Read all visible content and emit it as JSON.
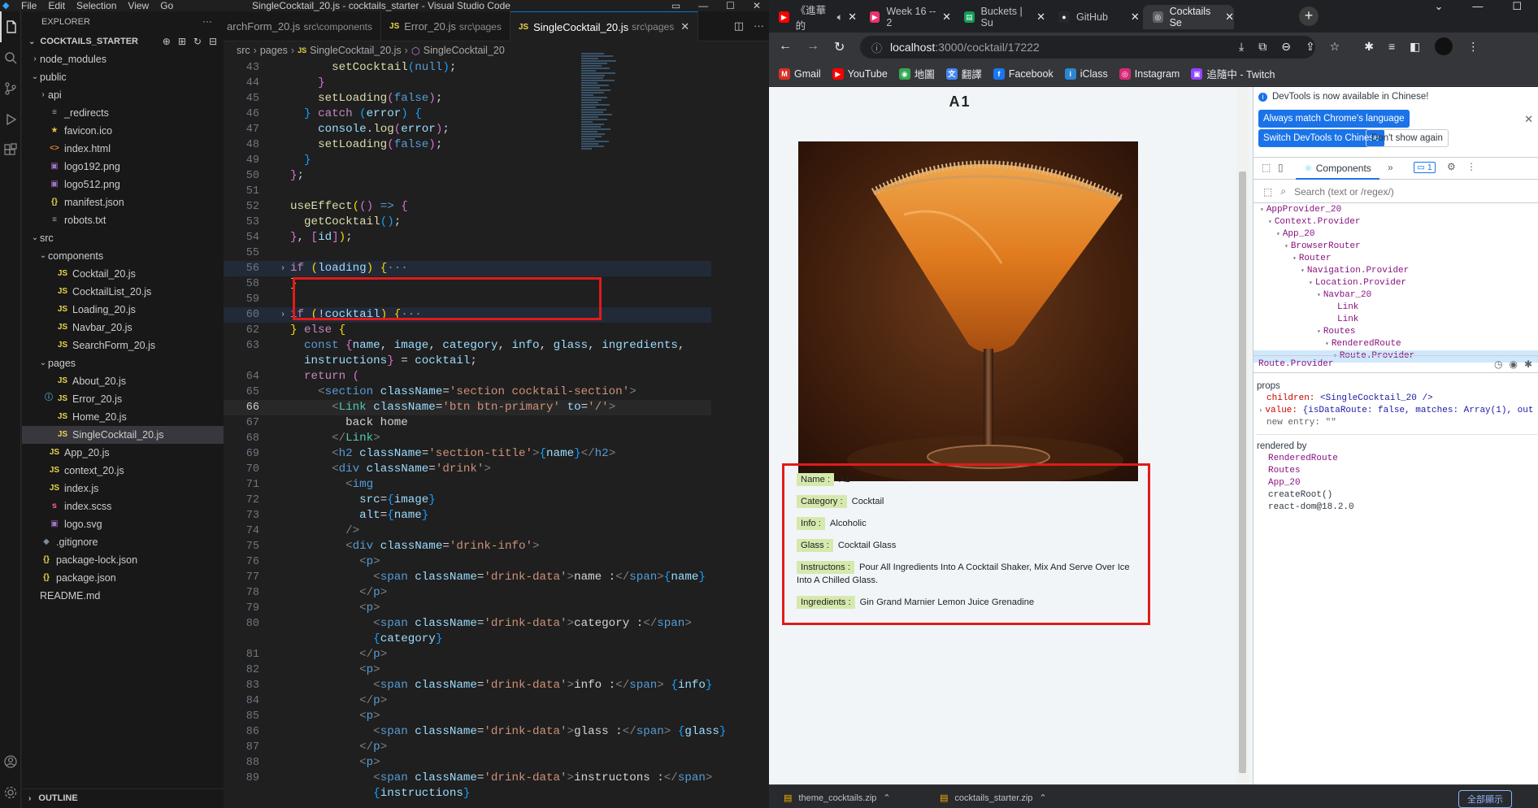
{
  "vscode": {
    "window_title": "SingleCocktail_20.js - cocktails_starter - Visual Studio Code",
    "menu": [
      "File",
      "Edit",
      "Selection",
      "View",
      "Go"
    ],
    "explorer_label": "EXPLORER",
    "project_label": "COCKTAILS_STARTER",
    "outline_label": "OUTLINE",
    "tree": [
      {
        "name": "node_modules",
        "kind": "folder",
        "depth": 0,
        "open": false,
        "icon": ""
      },
      {
        "name": "public",
        "kind": "folder",
        "depth": 0,
        "open": true,
        "icon": ""
      },
      {
        "name": "api",
        "kind": "folder",
        "depth": 1,
        "open": false,
        "icon": ""
      },
      {
        "name": "_redirects",
        "kind": "file",
        "depth": 1,
        "icon": "txt"
      },
      {
        "name": "favicon.ico",
        "kind": "file",
        "depth": 1,
        "icon": "star"
      },
      {
        "name": "index.html",
        "kind": "file",
        "depth": 1,
        "icon": "html"
      },
      {
        "name": "logo192.png",
        "kind": "file",
        "depth": 1,
        "icon": "img"
      },
      {
        "name": "logo512.png",
        "kind": "file",
        "depth": 1,
        "icon": "img"
      },
      {
        "name": "manifest.json",
        "kind": "file",
        "depth": 1,
        "icon": "json"
      },
      {
        "name": "robots.txt",
        "kind": "file",
        "depth": 1,
        "icon": "txt"
      },
      {
        "name": "src",
        "kind": "folder",
        "depth": 0,
        "open": true,
        "icon": ""
      },
      {
        "name": "components",
        "kind": "folder",
        "depth": 1,
        "open": true,
        "icon": ""
      },
      {
        "name": "Cocktail_20.js",
        "kind": "file",
        "depth": 2,
        "icon": "js"
      },
      {
        "name": "CocktailList_20.js",
        "kind": "file",
        "depth": 2,
        "icon": "js"
      },
      {
        "name": "Loading_20.js",
        "kind": "file",
        "depth": 2,
        "icon": "js"
      },
      {
        "name": "Navbar_20.js",
        "kind": "file",
        "depth": 2,
        "icon": "js"
      },
      {
        "name": "SearchForm_20.js",
        "kind": "file",
        "depth": 2,
        "icon": "js"
      },
      {
        "name": "pages",
        "kind": "folder",
        "depth": 1,
        "open": true,
        "icon": ""
      },
      {
        "name": "About_20.js",
        "kind": "file",
        "depth": 2,
        "icon": "js"
      },
      {
        "name": "Error_20.js",
        "kind": "file",
        "depth": 2,
        "icon": "js"
      },
      {
        "name": "Home_20.js",
        "kind": "file",
        "depth": 2,
        "icon": "js"
      },
      {
        "name": "SingleCocktail_20.js",
        "kind": "file",
        "depth": 2,
        "icon": "js",
        "selected": true
      },
      {
        "name": "App_20.js",
        "kind": "file",
        "depth": 1,
        "icon": "js"
      },
      {
        "name": "context_20.js",
        "kind": "file",
        "depth": 1,
        "icon": "js"
      },
      {
        "name": "index.js",
        "kind": "file",
        "depth": 1,
        "icon": "js"
      },
      {
        "name": "index.scss",
        "kind": "file",
        "depth": 1,
        "icon": "scss"
      },
      {
        "name": "logo.svg",
        "kind": "file",
        "depth": 1,
        "icon": "img"
      },
      {
        "name": ".gitignore",
        "kind": "file",
        "depth": 0,
        "icon": "git"
      },
      {
        "name": "package-lock.json",
        "kind": "file",
        "depth": 0,
        "icon": "json"
      },
      {
        "name": "package.json",
        "kind": "file",
        "depth": 0,
        "icon": "json"
      },
      {
        "name": "README.md",
        "kind": "file",
        "depth": 0,
        "icon": "info"
      }
    ],
    "tabs": [
      {
        "label": "archForm_20.js",
        "path": "src\\components",
        "active": false
      },
      {
        "label": "Error_20.js",
        "path": "src\\pages",
        "active": false
      },
      {
        "label": "SingleCocktail_20.js",
        "path": "src\\pages",
        "active": true
      }
    ],
    "breadcrumb": [
      "src",
      "pages",
      "SingleCocktail_20.js",
      "SingleCocktail_20"
    ],
    "current_line": "66"
  },
  "browser": {
    "tabs": [
      {
        "label": "《進華的",
        "icon": "youtube-icon",
        "color": "#ff0000"
      },
      {
        "label": "Week 16 -- 2",
        "icon": "play-icon",
        "color": "#e8336d"
      },
      {
        "label": "Buckets | Su",
        "icon": "chart-icon",
        "color": "#0f9d58"
      },
      {
        "label": "GitHub",
        "icon": "github-icon",
        "color": "#24292e"
      },
      {
        "label": "Cocktails Se",
        "icon": "globe-icon",
        "color": "#9aa0a6",
        "active": true
      }
    ],
    "url_host": "localhost",
    "url_rest": ":3000/cocktail/17222",
    "bookmarks": [
      {
        "label": "Gmail",
        "color": "#d93025",
        "glyph": "M"
      },
      {
        "label": "YouTube",
        "color": "#ff0000",
        "glyph": "▶"
      },
      {
        "label": "地圖",
        "color": "#34a853",
        "glyph": "◉"
      },
      {
        "label": "翻譯",
        "color": "#4285f4",
        "glyph": "文"
      },
      {
        "label": "Facebook",
        "color": "#1877f2",
        "glyph": "f"
      },
      {
        "label": "iClass",
        "color": "#2c86d2",
        "glyph": "i"
      },
      {
        "label": "Instagram",
        "color": "#d62976",
        "glyph": "◎"
      },
      {
        "label": "追隨中 - Twitch",
        "color": "#9146ff",
        "glyph": "▣"
      }
    ],
    "downloads": [
      "theme_cocktails.zip",
      "cocktails_starter.zip"
    ],
    "downloads_showall": "全部顯示"
  },
  "cocktail_page": {
    "title": "A1",
    "fields": [
      {
        "label": "Name :",
        "value": "A1"
      },
      {
        "label": "Category :",
        "value": "Cocktail"
      },
      {
        "label": "Info :",
        "value": "Alcoholic"
      },
      {
        "label": "Glass :",
        "value": "Cocktail Glass"
      },
      {
        "label": "Instructons :",
        "value": "Pour All Ingredients Into A Cocktail Shaker, Mix And Serve Over Ice Into A Chilled Glass."
      },
      {
        "label": "Ingredients :",
        "value": "Gin  Grand Marnier  Lemon Juice  Grenadine"
      }
    ]
  },
  "devtools": {
    "notice": "DevTools is now available in Chinese!",
    "btn_match": "Always match Chrome's language",
    "btn_switch": "Switch DevTools to Chinese",
    "btn_dontshow": "Don't show again",
    "components_tab": "Components",
    "message_count": "1",
    "search_placeholder": "Search (text or /regex/)",
    "tree": [
      {
        "name": "AppProvider_20",
        "depth": 0
      },
      {
        "name": "Context.Provider",
        "depth": 1
      },
      {
        "name": "App_20",
        "depth": 2
      },
      {
        "name": "BrowserRouter",
        "depth": 3
      },
      {
        "name": "Router",
        "depth": 4
      },
      {
        "name": "Navigation.Provider",
        "depth": 5
      },
      {
        "name": "Location.Provider",
        "depth": 6
      },
      {
        "name": "Navbar_20",
        "depth": 7
      },
      {
        "name": "Link",
        "depth": 8
      },
      {
        "name": "Link",
        "depth": 8
      },
      {
        "name": "Routes",
        "depth": 7
      },
      {
        "name": "RenderedRoute",
        "depth": 8
      },
      {
        "name": "Route.Provider",
        "depth": 9,
        "selected": true
      }
    ],
    "selected_component": "Route.Provider",
    "props_title": "props",
    "props": [
      {
        "key": "children:",
        "value": "<SingleCocktail_20 />"
      },
      {
        "key": "value:",
        "value": "{isDataRoute: false, matches: Array(1), out"
      },
      {
        "key": "new entry:",
        "value": "\"\""
      }
    ],
    "rendered_by_title": "rendered by",
    "rendered_by": [
      "RenderedRoute",
      "Routes",
      "App_20",
      "createRoot()",
      "react-dom@18.2.0"
    ]
  }
}
